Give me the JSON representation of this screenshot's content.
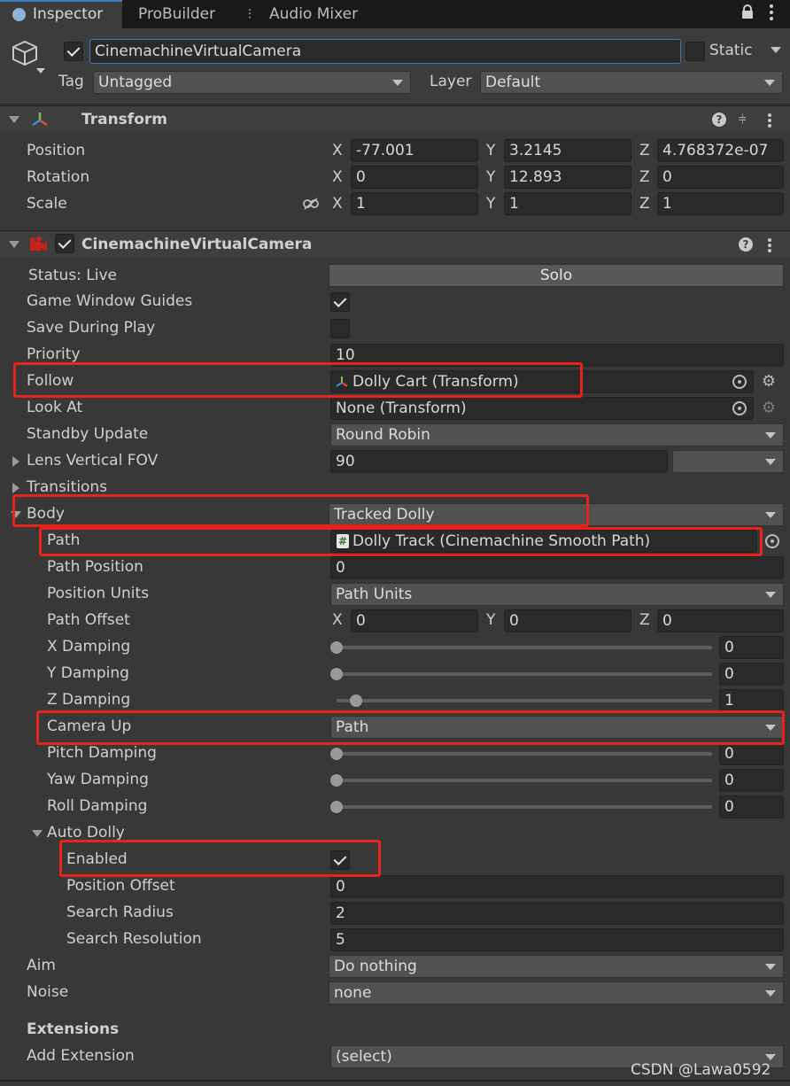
{
  "tabs": [
    {
      "label": "Inspector",
      "icon": "info-icon"
    },
    {
      "label": "ProBuilder"
    },
    {
      "label": "Audio Mixer",
      "icon": "mixer-icon"
    }
  ],
  "header": {
    "object_name": "CinemachineVirtualCamera",
    "static_label": "Static",
    "tag_label": "Tag",
    "tag_value": "Untagged",
    "layer_label": "Layer",
    "layer_value": "Default"
  },
  "transform": {
    "title": "Transform",
    "position_label": "Position",
    "rotation_label": "Rotation",
    "scale_label": "Scale",
    "position": {
      "x": "-77.001",
      "y": "3.2145",
      "z": "4.768372e-07"
    },
    "rotation": {
      "x": "0",
      "y": "12.893",
      "z": "0"
    },
    "scale": {
      "x": "1",
      "y": "1",
      "z": "1"
    },
    "axis_x": "X",
    "axis_y": "Y",
    "axis_z": "Z"
  },
  "vcam": {
    "title": "CinemachineVirtualCamera",
    "status_label": "Status: Live",
    "solo_label": "Solo",
    "game_window_guides_label": "Game Window Guides",
    "save_during_play_label": "Save During Play",
    "priority_label": "Priority",
    "priority_value": "10",
    "follow_label": "Follow",
    "follow_value": "Dolly Cart (Transform)",
    "look_at_label": "Look At",
    "look_at_value": "None (Transform)",
    "standby_label": "Standby Update",
    "standby_value": "Round Robin",
    "lens_label": "Lens Vertical FOV",
    "lens_value": "90",
    "transitions_label": "Transitions",
    "body_label": "Body",
    "body_value": "Tracked Dolly",
    "path_label": "Path",
    "path_value": "Dolly Track (Cinemachine Smooth Path)",
    "path_position_label": "Path Position",
    "path_position_value": "0",
    "position_units_label": "Position Units",
    "position_units_value": "Path Units",
    "path_offset_label": "Path Offset",
    "path_offset": {
      "x": "0",
      "y": "0",
      "z": "0"
    },
    "x_damping_label": "X Damping",
    "x_damping_value": "0",
    "y_damping_label": "Y Damping",
    "y_damping_value": "0",
    "z_damping_label": "Z Damping",
    "z_damping_value": "1",
    "camera_up_label": "Camera Up",
    "camera_up_value": "Path",
    "pitch_damping_label": "Pitch Damping",
    "pitch_damping_value": "0",
    "yaw_damping_label": "Yaw Damping",
    "yaw_damping_value": "0",
    "roll_damping_label": "Roll Damping",
    "roll_damping_value": "0",
    "auto_dolly_label": "Auto Dolly",
    "enabled_label": "Enabled",
    "position_offset_label": "Position Offset",
    "position_offset_value": "0",
    "search_radius_label": "Search Radius",
    "search_radius_value": "2",
    "search_resolution_label": "Search Resolution",
    "search_resolution_value": "5",
    "aim_label": "Aim",
    "aim_value": "Do nothing",
    "noise_label": "Noise",
    "noise_value": "none",
    "extensions_label": "Extensions",
    "add_extension_label": "Add Extension",
    "add_extension_value": "(select)"
  },
  "watermark": "CSDN @Lawa0592",
  "colors": {
    "highlight": "#e8231b",
    "accent": "#3a79bb"
  }
}
